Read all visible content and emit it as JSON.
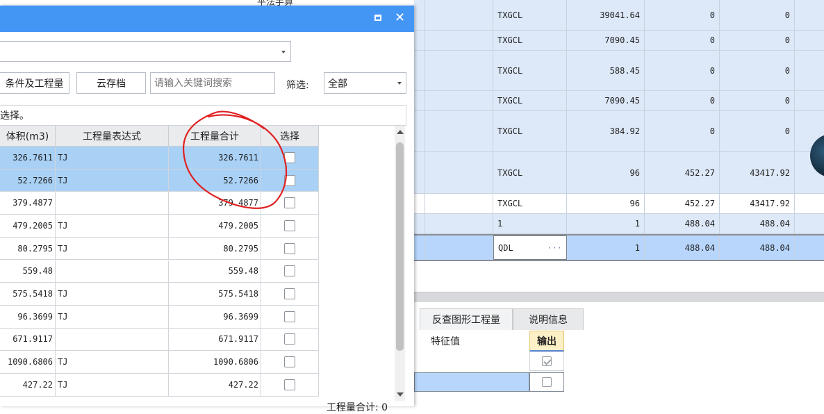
{
  "background_table": {
    "top_label": "平法手算",
    "rows": [
      {
        "code": "TXGCL",
        "qty": "39041.64",
        "price": "0",
        "amount": "0",
        "style": "sel"
      },
      {
        "code": "TXGCL",
        "qty": "7090.45",
        "price": "0",
        "amount": "0",
        "style": "sel"
      },
      {
        "code": "TXGCL",
        "qty": "588.45",
        "price": "0",
        "amount": "0",
        "style": "sel"
      },
      {
        "code": "TXGCL",
        "qty": "7090.45",
        "price": "0",
        "amount": "0",
        "style": "sel"
      },
      {
        "code": "TXGCL",
        "qty": "384.92",
        "price": "0",
        "amount": "0",
        "style": "sel"
      },
      {
        "code": "TXGCL",
        "qty": "96",
        "price": "452.27",
        "amount": "43417.92",
        "style": "sel"
      },
      {
        "code": "TXGCL",
        "qty": "96",
        "price": "452.27",
        "amount": "43417.92",
        "style": "white"
      },
      {
        "code": "1",
        "qty": "1",
        "price": "488.04",
        "amount": "488.04",
        "style": "sel"
      },
      {
        "code": "QDL",
        "qty": "1",
        "price": "488.04",
        "amount": "488.04",
        "style": "active"
      }
    ]
  },
  "bottom_tabs": [
    {
      "label": "反查图形工程量",
      "active": true
    },
    {
      "label": "说明信息",
      "active": false
    }
  ],
  "property_panel": {
    "col_feature": "特征值",
    "col_output": "输出",
    "rows": [
      {
        "output_checked": true
      },
      {
        "output_checked": false
      }
    ]
  },
  "dialog": {
    "toolbar": {
      "conditions_button": "条件及工程量",
      "cloud_button": "云存档",
      "search_placeholder": "请输入关键词搜索",
      "filter_label": "筛选:",
      "filter_value": "全部"
    },
    "hint": "选择。",
    "columns": [
      "体积(m3)",
      "工程量表达式",
      "工程量合计",
      "选择"
    ],
    "rows": [
      {
        "volume": "326.7611",
        "expr": "TJ",
        "total": "326.7611",
        "selected": true
      },
      {
        "volume": "52.7266",
        "expr": "TJ",
        "total": "52.7266",
        "selected": true
      },
      {
        "volume": "379.4877",
        "expr": "",
        "total": "379.4877",
        "selected": false
      },
      {
        "volume": "479.2005",
        "expr": "TJ",
        "total": "479.2005",
        "selected": false
      },
      {
        "volume": "80.2795",
        "expr": "TJ",
        "total": "80.2795",
        "selected": false
      },
      {
        "volume": "559.48",
        "expr": "",
        "total": "559.48",
        "selected": false
      },
      {
        "volume": "575.5418",
        "expr": "TJ",
        "total": "575.5418",
        "selected": false
      },
      {
        "volume": "96.3699",
        "expr": "TJ",
        "total": "96.3699",
        "selected": false
      },
      {
        "volume": "671.9117",
        "expr": "",
        "total": "671.9117",
        "selected": false
      },
      {
        "volume": "1090.6806",
        "expr": "TJ",
        "total": "1090.6806",
        "selected": false
      },
      {
        "volume": "427.22",
        "expr": "TJ",
        "total": "427.22",
        "selected": false
      }
    ],
    "footer_total": "工程量合计: 0"
  },
  "colors": {
    "titlebar": "#4496f5",
    "row_selected": "#a9d0f5",
    "annotation": "#e02020"
  },
  "icons": {
    "maximize": "maximize-icon",
    "close": "close-icon",
    "dropdown": "chevron-down-icon"
  }
}
